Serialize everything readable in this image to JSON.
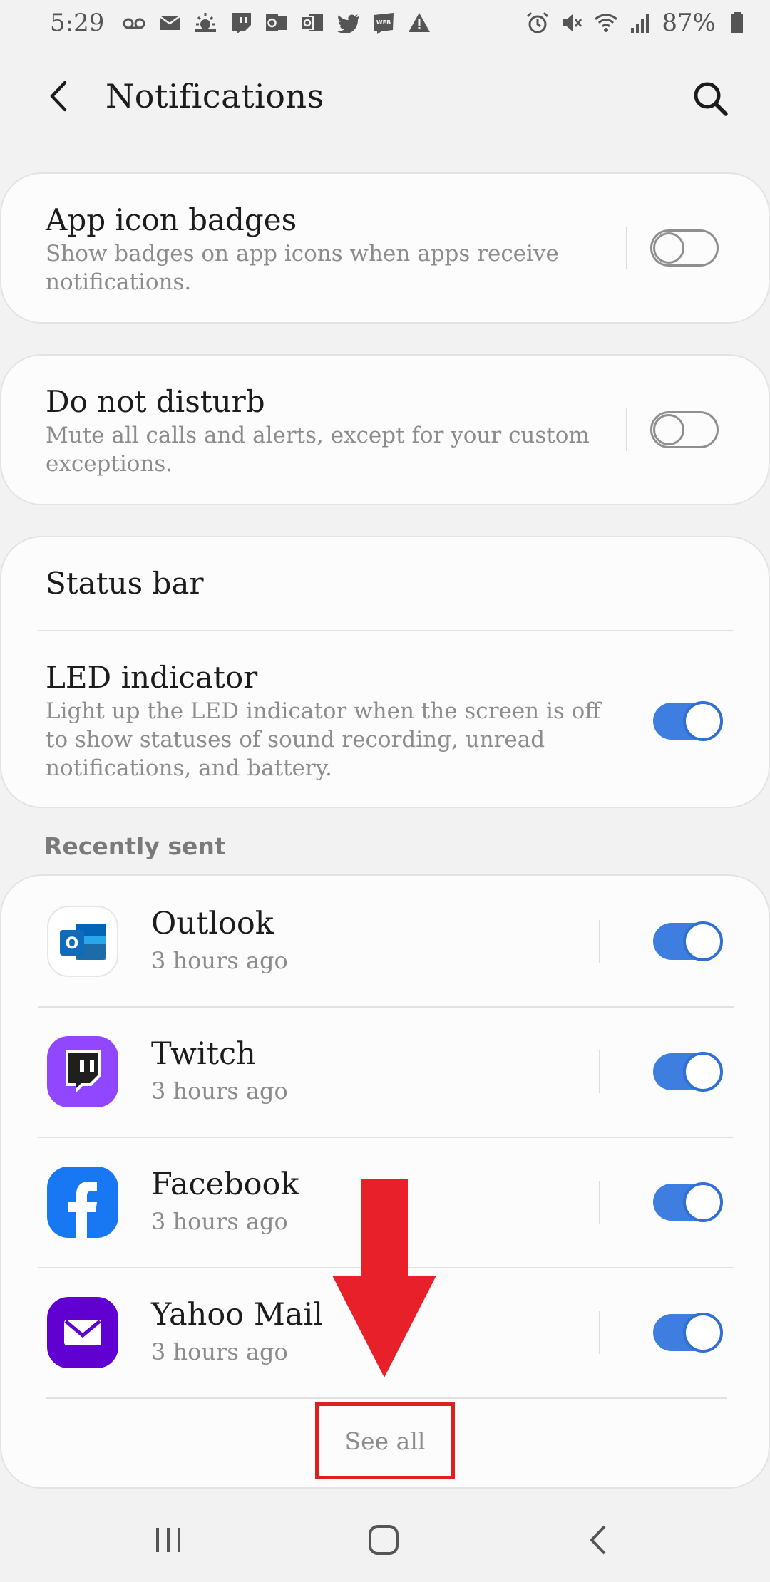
{
  "status_bar": {
    "time": "5:29",
    "left_icons": [
      "voicemail-icon",
      "mail-icon",
      "weather-icon",
      "twitch-icon",
      "outlook-icon",
      "office-icon",
      "twitter-icon",
      "webtoon-icon",
      "warning-icon"
    ],
    "right_icons": [
      "alarm-icon",
      "mute-icon",
      "wifi-icon",
      "signal-icon"
    ],
    "battery": "87%"
  },
  "header": {
    "title": "Notifications"
  },
  "settings": {
    "app_icon_badges": {
      "title": "App icon badges",
      "subtitle": "Show badges on app icons when apps receive notifications.",
      "enabled": false
    },
    "do_not_disturb": {
      "title": "Do not disturb",
      "subtitle": "Mute all calls and alerts, except for your custom exceptions.",
      "enabled": false
    },
    "status_bar": {
      "title": "Status bar"
    },
    "led_indicator": {
      "title": "LED indicator",
      "subtitle": "Light up the LED indicator when the screen is off to show statuses of sound recording, unread notifications, and battery.",
      "enabled": true
    }
  },
  "recently_sent": {
    "label": "Recently sent",
    "apps": [
      {
        "name": "Outlook",
        "time": "3 hours ago",
        "enabled": true,
        "icon": "outlook-app-icon",
        "color": "#0f6cbd"
      },
      {
        "name": "Twitch",
        "time": "3 hours ago",
        "enabled": true,
        "icon": "twitch-app-icon",
        "color": "#9146ff"
      },
      {
        "name": "Facebook",
        "time": "3 hours ago",
        "enabled": true,
        "icon": "facebook-app-icon",
        "color": "#1877f2"
      },
      {
        "name": "Yahoo Mail",
        "time": "3 hours ago",
        "enabled": true,
        "icon": "yahoo-mail-app-icon",
        "color": "#6001d2"
      }
    ],
    "see_all": "See all"
  },
  "colors": {
    "accent": "#3e7ee0",
    "highlight": "#e02020",
    "background": "#f2f2f2"
  }
}
